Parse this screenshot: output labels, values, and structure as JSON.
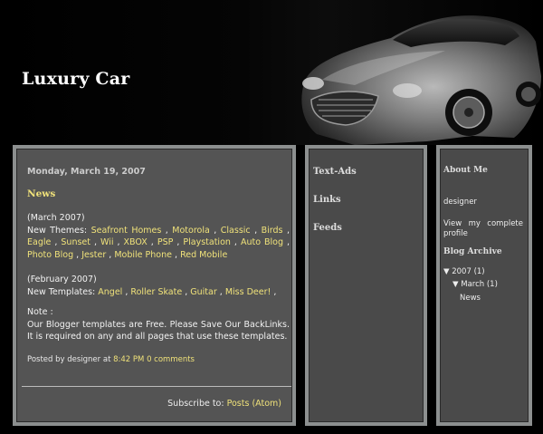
{
  "header": {
    "title": "Luxury Car"
  },
  "post": {
    "date": "Monday, March 19, 2007",
    "title": "News",
    "march_label": "(March 2007)",
    "new_themes_label": "New Themes:",
    "themes": [
      "Seafront Homes",
      "Motorola",
      "Classic",
      "Birds",
      "Eagle",
      "Sunset",
      "Wii",
      "XBOX",
      "PSP",
      "Playstation",
      "Auto Blog",
      "Photo Blog",
      "Jester",
      "Mobile Phone",
      "Red Mobile"
    ],
    "feb_label": "(February 2007)",
    "new_templates_label": "New Templates:",
    "templates": [
      "Angel",
      "Roller Skate",
      "Guitar",
      "Miss Deer!"
    ],
    "note_label": "Note :",
    "note_text": "Our Blogger templates are Free. Please Save Our BackLinks. It is required on any and all pages that use these templates.",
    "posted_by": "Posted by designer at",
    "time": "8:42 PM",
    "comments": "0 comments",
    "subscribe_label": "Subscribe to:",
    "subscribe_link": "Posts (Atom)"
  },
  "middle": {
    "items": [
      "Text-Ads",
      "Links",
      "Feeds"
    ]
  },
  "sidebar": {
    "about_title": "About Me",
    "author": "designer",
    "profile_link": "View my complete profile",
    "archive_title": "Blog Archive",
    "year": "▼ 2007 (1)",
    "month": "▼ March (1)",
    "entry": "News"
  },
  "colors": {
    "link": "#f0e27a",
    "panel_border": "#8c8f8f",
    "panel_bg": "#4a4a4a"
  }
}
